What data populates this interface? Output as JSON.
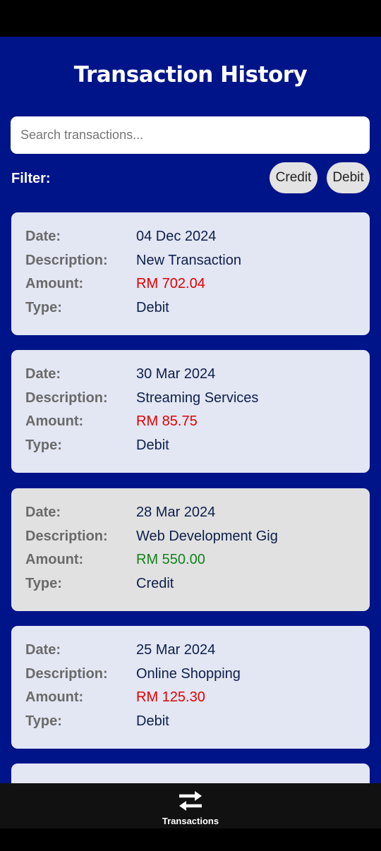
{
  "header": {
    "title": "Transaction History"
  },
  "search": {
    "placeholder": "Search transactions..."
  },
  "filter": {
    "label": "Filter:",
    "options": [
      "Credit",
      "Debit"
    ]
  },
  "labels": {
    "date": "Date:",
    "description": "Description:",
    "amount": "Amount:",
    "type": "Type:"
  },
  "transactions": [
    {
      "date": "04 Dec 2024",
      "description": "New Transaction",
      "amount": "RM 702.04",
      "type": "Debit"
    },
    {
      "date": "30 Mar 2024",
      "description": "Streaming Services",
      "amount": "RM 85.75",
      "type": "Debit"
    },
    {
      "date": "28 Mar 2024",
      "description": "Web Development Gig",
      "amount": "RM 550.00",
      "type": "Credit"
    },
    {
      "date": "25 Mar 2024",
      "description": "Online Shopping",
      "amount": "RM 125.30",
      "type": "Debit"
    }
  ],
  "colors": {
    "header_bg": "#001489",
    "debit_amount": "#e00000",
    "credit_amount": "#12821d",
    "debit_card": "#e3e6f3",
    "credit_card": "#e1e1e1"
  },
  "bottom_nav": {
    "label": "Transactions",
    "icon": "swap-arrows-icon"
  }
}
